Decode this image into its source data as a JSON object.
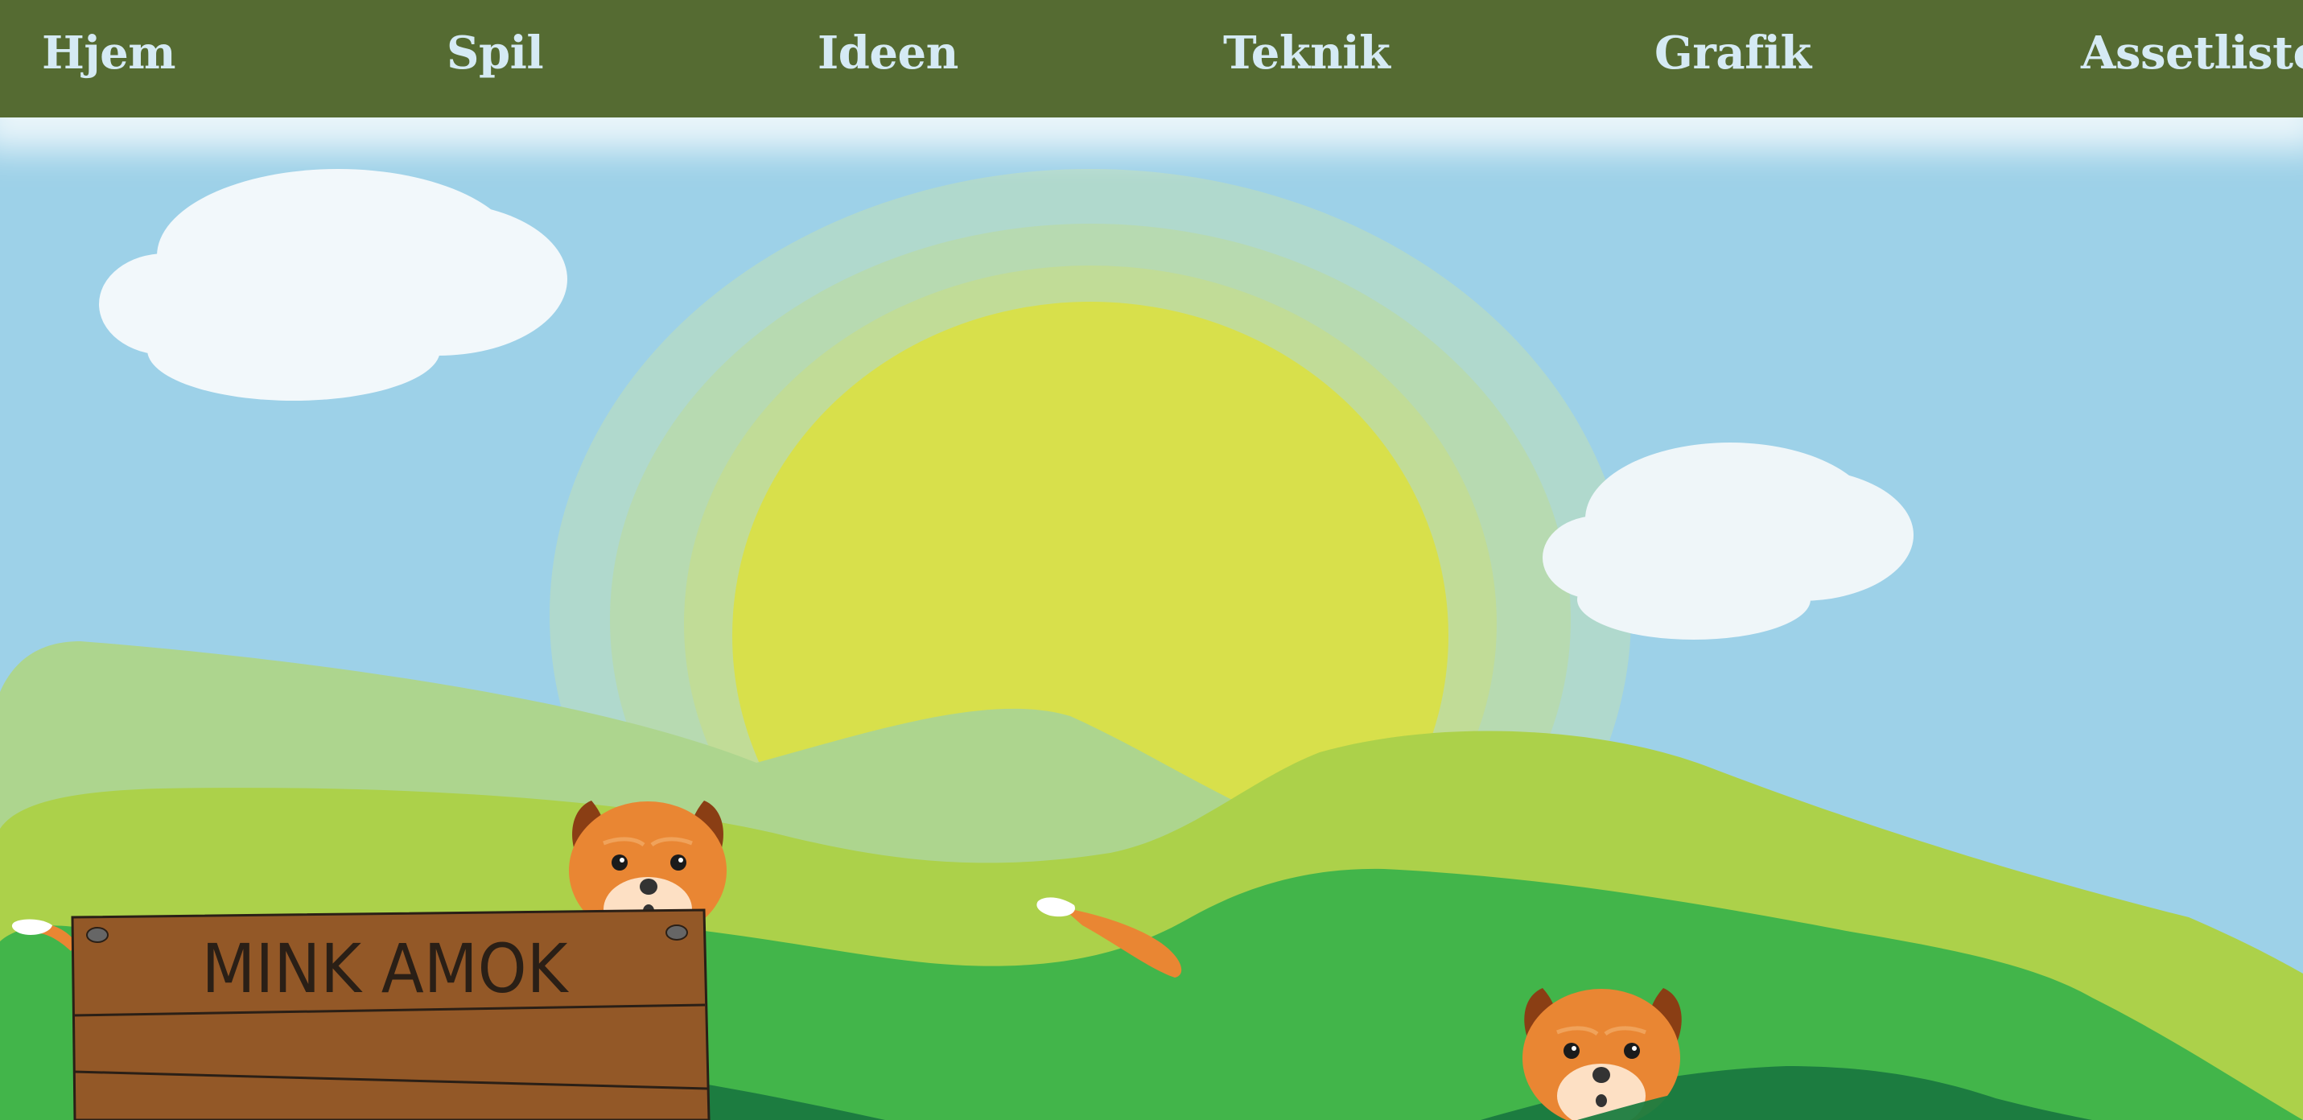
{
  "nav": {
    "items": [
      {
        "id": "hjem",
        "label": "Hjem"
      },
      {
        "id": "spil",
        "label": "Spil"
      },
      {
        "id": "ideen",
        "label": "Ideen"
      },
      {
        "id": "teknik",
        "label": "Teknik"
      },
      {
        "id": "grafik",
        "label": "Grafik"
      },
      {
        "id": "assetliste",
        "label": "Assetliste"
      }
    ]
  },
  "sign": {
    "title": "MINK AMOK"
  },
  "colors": {
    "nav_bg": "#556b32",
    "nav_text": "#d5eaf4",
    "sky": "#9dd1e8",
    "sun": "#d8e04b",
    "sign_wood": "#935827",
    "mink_orange": "#e98633"
  }
}
